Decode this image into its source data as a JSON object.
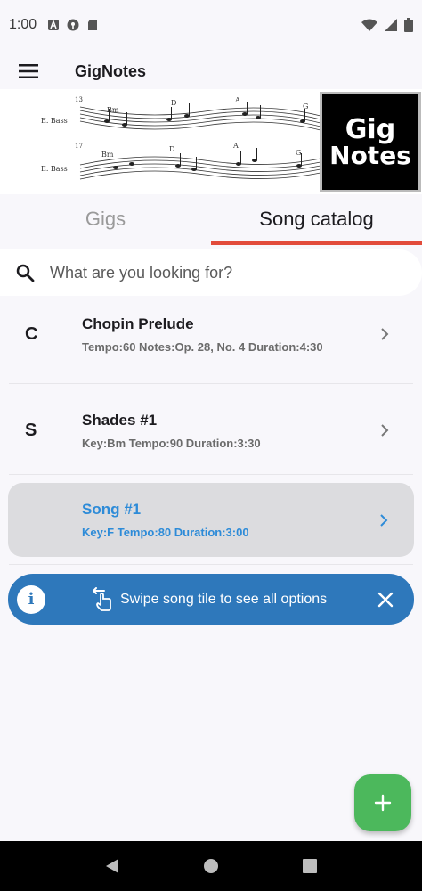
{
  "status_bar": {
    "time": "1:00",
    "left_icons": [
      "a-icon",
      "podcast-icon",
      "sd-card-icon"
    ],
    "right_icons": [
      "wifi-icon",
      "signal-icon",
      "battery-icon"
    ]
  },
  "app_bar": {
    "title": "GigNotes",
    "menu_icon": "menu-icon"
  },
  "banner": {
    "logo_line1": "Gig",
    "logo_line2": "Notes",
    "score_labels": {
      "instrument_top": "E. Bass",
      "instrument_bottom": "E. Bass",
      "measure_top": "13",
      "measure_bottom": "17",
      "chords_top": [
        "Bm",
        "D",
        "A",
        "G"
      ],
      "chords_bottom": [
        "Bm",
        "D",
        "A",
        "G"
      ]
    }
  },
  "tabs": [
    {
      "label": "Gigs",
      "active": false
    },
    {
      "label": "Song catalog",
      "active": true
    }
  ],
  "search": {
    "placeholder": "What are you looking for?"
  },
  "songs": [
    {
      "letter": "C",
      "title": "Chopin Prelude",
      "meta": "Tempo:60  Notes:Op. 28, No. 4  Duration:4:30",
      "selected": false
    },
    {
      "letter": "S",
      "title": "Shades #1",
      "meta": "Key:Bm  Tempo:90  Duration:3:30",
      "selected": false
    },
    {
      "letter": "",
      "title": "Song #1",
      "meta": "Key:F  Tempo:80  Duration:3:00",
      "selected": true
    }
  ],
  "snackbar": {
    "text": "Swipe song tile to see all options",
    "info_icon_glyph": "i"
  },
  "fab": {
    "icon": "plus-icon"
  },
  "colors": {
    "accent_indicator": "#e24b3b",
    "selected_text": "#2d8bd8",
    "snackbar_bg": "#2e78bb",
    "fab_bg": "#4cb85c"
  }
}
